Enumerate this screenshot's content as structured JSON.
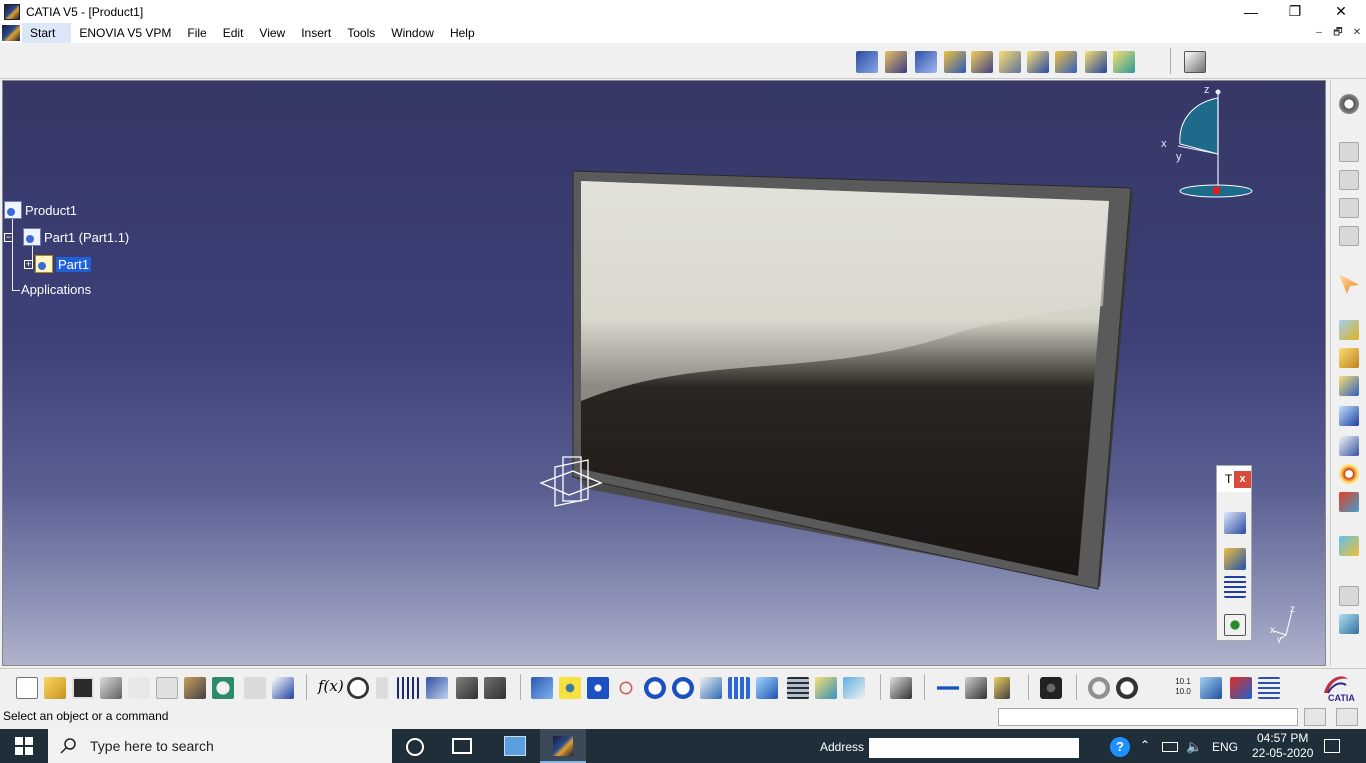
{
  "window": {
    "title": "CATIA V5 - [Product1]",
    "minimize": "—",
    "restore": "❐",
    "close": "✕"
  },
  "menu": {
    "items": [
      "Start",
      "ENOVIA V5 VPM",
      "File",
      "Edit",
      "View",
      "Insert",
      "Tools",
      "Window",
      "Help"
    ],
    "mdi_min": "–",
    "mdi_restore": "🗗",
    "mdi_close": "✕"
  },
  "tree": {
    "root": "Product1",
    "child": "Part1 (Part1.1)",
    "part": "Part1",
    "applications": "Applications"
  },
  "compass": {
    "z": "z",
    "x": "x",
    "y": "y"
  },
  "axis_triad": {
    "z": "z",
    "x": "x",
    "y": "y"
  },
  "float_toolbar": {
    "title": "T",
    "close": "x"
  },
  "status": {
    "message": "Select an object or a command",
    "command_input": ""
  },
  "taskbar": {
    "search_placeholder": "Type here to search",
    "address_label": "Address",
    "language": "ENG",
    "time": "04:57 PM",
    "date": "22-05-2020"
  },
  "colors": {
    "viewport_top": "#363766",
    "viewport_bottom": "#b0b3cc",
    "selection": "#2060d8",
    "taskbar": "#1f2f3a"
  }
}
